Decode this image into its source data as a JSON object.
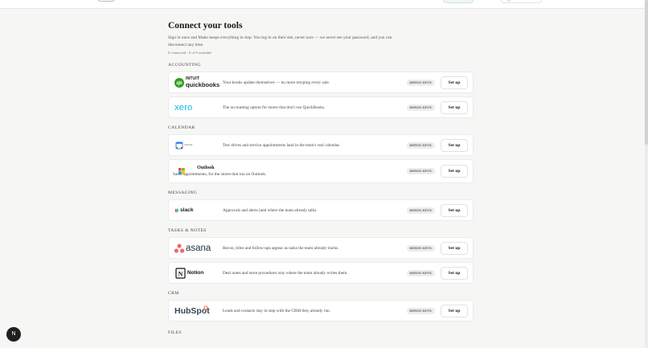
{
  "page": {
    "title": "Connect your tools",
    "subtitle": "Sign in once and Mako keeps everything in step. You log in on their site, never ours — we never see your password, and you can disconnect any time.",
    "count": "0 connected · 0 of 9 available"
  },
  "sections": [
    {
      "label": "ACCOUNTING"
    },
    {
      "label": "CALENDAR"
    },
    {
      "label": "MESSAGING"
    },
    {
      "label": "TASKS & NOTES"
    },
    {
      "label": "CRM"
    },
    {
      "label": "FILES"
    }
  ],
  "integrations": {
    "quickbooks": {
      "logo_top": "INTUIT",
      "logo_bottom": "quickbooks",
      "desc": "Your books update themselves — no more retyping every sale.",
      "badge": "NEEDS KEYS",
      "action": "Set up"
    },
    "xero": {
      "logo": "xero",
      "desc": "The accounting option for stores that don't run QuickBooks.",
      "badge": "NEEDS KEYS",
      "action": "Set up"
    },
    "gcal": {
      "logo": "Calendar",
      "desc": "Test drives and service appointments land in the team's real calendar.",
      "badge": "NEEDS KEYS",
      "action": "Set up"
    },
    "outlook": {
      "title": "Outlook",
      "desc": "Same appointments, for the stores that run on Outlook.",
      "badge": "NEEDS KEYS",
      "action": "Set up"
    },
    "slack": {
      "logo": "slack",
      "desc": "Approvals and alerts land where the team already talks.",
      "badge": "NEEDS KEYS",
      "action": "Set up"
    },
    "asana": {
      "logo": "asana",
      "desc": "Recon, titles and follow-ups appear as tasks the team already tracks.",
      "badge": "NEEDS KEYS",
      "action": "Set up"
    },
    "notion": {
      "logo": "Notion",
      "desc": "Deal notes and store procedures stay where the team already writes them.",
      "badge": "NEEDS KEYS",
      "action": "Set up"
    },
    "hubspot": {
      "logo": "HubSpot",
      "desc": "Leads and contacts stay in step with the CRM they already run.",
      "badge": "NEEDS KEYS",
      "action": "Set up"
    }
  },
  "help_button": {
    "label": "N"
  },
  "colors": {
    "quickbooks": "#2ca01c",
    "xero": "#13b5ea",
    "asana": "#f06a6a",
    "hubspot": "#33475b",
    "hubspot_accent": "#ff7a59"
  }
}
